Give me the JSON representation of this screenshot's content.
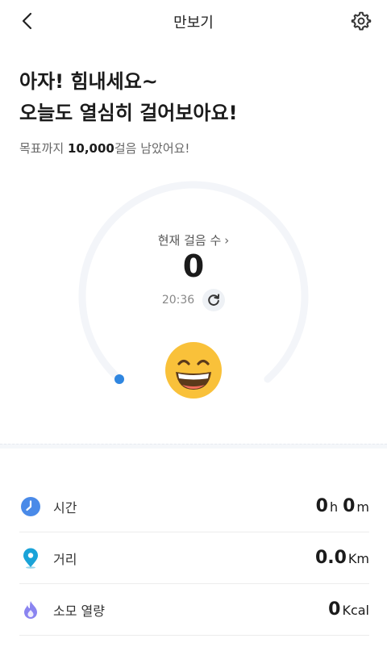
{
  "header": {
    "title": "만보기",
    "back_icon": "chevron-left-icon",
    "settings_icon": "gear-icon"
  },
  "headline": {
    "line1": "아자! 힘내세요~",
    "line2": "오늘도 열심히 걸어보아요!"
  },
  "goal": {
    "prefix": "목표까지 ",
    "steps": "10,000",
    "suffix": "걸음 남았어요!"
  },
  "gauge": {
    "label": "현재 걸음 수",
    "chevron": "›",
    "count": "0",
    "time": "20:36",
    "progress": 0,
    "track_color": "#f3f5f9",
    "dot_color": "#2f86e0",
    "emoji": "grinning-face-icon"
  },
  "stats": [
    {
      "label": "시간",
      "icon": "clock-icon",
      "color": "#4a8ae8",
      "parts": [
        {
          "num": "0",
          "unit": "h"
        },
        {
          "num": "0",
          "unit": "m"
        }
      ]
    },
    {
      "label": "거리",
      "icon": "location-pin-icon",
      "color": "#1aa3d8",
      "parts": [
        {
          "num": "0.0",
          "unit": "Km"
        }
      ]
    },
    {
      "label": "소모 열량",
      "icon": "flame-icon",
      "color": "#8a84f0",
      "parts": [
        {
          "num": "0",
          "unit": "Kcal"
        }
      ]
    }
  ]
}
